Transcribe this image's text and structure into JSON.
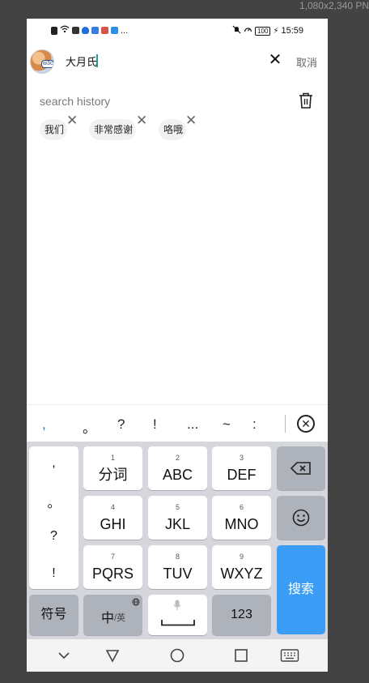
{
  "screen_resolution": "1,080x2,340 PN",
  "status_bar": {
    "time": "15:59",
    "battery": "100",
    "more": "..."
  },
  "search": {
    "value": "大月氏",
    "clear_label": "✕",
    "cancel_label": "取消"
  },
  "history": {
    "title": "search history",
    "tags": [
      "我们",
      "非常感谢",
      "咯哦"
    ]
  },
  "candidates": [
    ",",
    "。",
    "?",
    "!",
    "...",
    "~",
    ":"
  ],
  "keyboard": {
    "punctuation": [
      ",",
      "。",
      "?",
      "!"
    ],
    "keys": [
      {
        "num": "1",
        "label": "分词"
      },
      {
        "num": "2",
        "label": "ABC"
      },
      {
        "num": "3",
        "label": "DEF"
      },
      {
        "num": "4",
        "label": "GHI"
      },
      {
        "num": "5",
        "label": "JKL"
      },
      {
        "num": "6",
        "label": "MNO"
      },
      {
        "num": "7",
        "label": "PQRS"
      },
      {
        "num": "8",
        "label": "TUV"
      },
      {
        "num": "9",
        "label": "WXYZ"
      }
    ],
    "symbols_label": "符号",
    "lang_label_main": "中",
    "lang_label_sub": "/英",
    "numbers_label": "123",
    "search_label": "搜索"
  },
  "colors": {
    "accent": "#3a9cf5",
    "keyboard_bg": "#d5d7dd",
    "dark_key": "#adb2bb",
    "caret": "#1aa39a"
  }
}
